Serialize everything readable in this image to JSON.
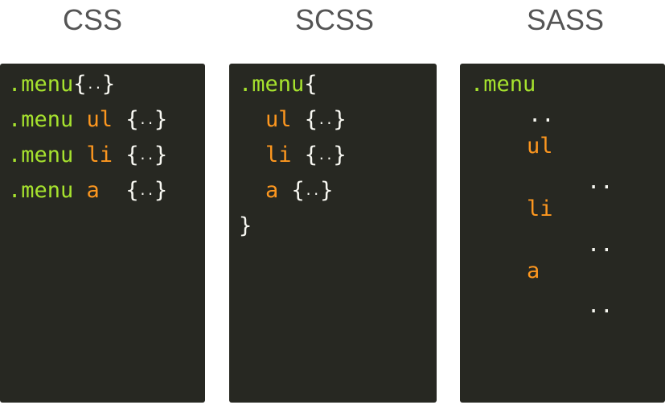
{
  "columns": {
    "css": {
      "title": "CSS"
    },
    "scss": {
      "title": "SCSS"
    },
    "sass": {
      "title": "SASS"
    }
  },
  "code": {
    "selector": ".menu",
    "tags": [
      "ul",
      "li",
      "a"
    ],
    "open_brace": "{",
    "close_brace": "}",
    "dots": "..",
    "empty_block": "{..}"
  },
  "colors": {
    "panel_bg": "#272822",
    "selector": "#a6e22e",
    "tag": "#fd971f",
    "brace": "#f8f8f2",
    "title": "#555555"
  }
}
